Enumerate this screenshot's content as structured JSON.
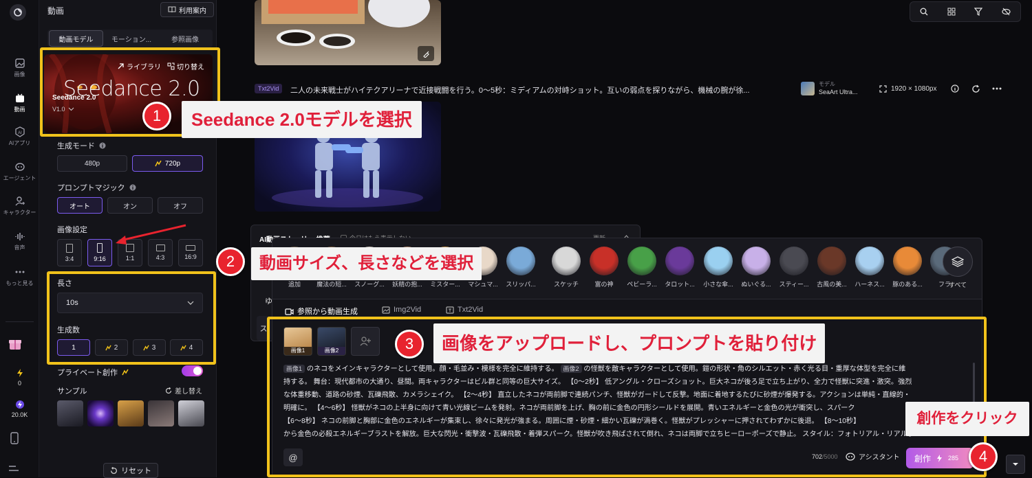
{
  "rail": {
    "items": [
      {
        "label": "画像",
        "icon": "image-icon"
      },
      {
        "label": "動画",
        "icon": "video-icon"
      },
      {
        "label": "AIアプリ",
        "icon": "ai-app-icon"
      },
      {
        "label": "エージェント",
        "icon": "agent-icon"
      },
      {
        "label": "キャラクター",
        "icon": "character-icon"
      },
      {
        "label": "音声",
        "icon": "audio-icon"
      },
      {
        "label": "もっと見る",
        "icon": "more-icon"
      }
    ],
    "stat1": "0",
    "stat2": "20.0K"
  },
  "panel": {
    "title": "動画",
    "guide_label": "利用案内",
    "tabs": [
      "動画モデル",
      "モーション...",
      "参照画像"
    ],
    "model": {
      "library_label": "ライブラリ",
      "switch_label": "切り替え",
      "logo_text": "Seedance 2.0",
      "name": "Seedance 2.0",
      "version": "V1.0"
    },
    "gen_mode": {
      "label": "生成モード",
      "options": [
        "480p",
        "720p"
      ],
      "selected": "720p"
    },
    "prompt_magic": {
      "label": "プロンプトマジック",
      "options": [
        "オート",
        "オン",
        "オフ"
      ],
      "selected": "オート"
    },
    "image_settings": {
      "label": "画像設定",
      "ratios": [
        "3:4",
        "9:16",
        "1:1",
        "4:3",
        "16:9"
      ],
      "selected": "9:16"
    },
    "length": {
      "label": "長さ",
      "value": "10s"
    },
    "count": {
      "label": "生成数",
      "options": [
        "1",
        "2",
        "3",
        "4"
      ],
      "selected": "1"
    },
    "private": {
      "label": "プライベート創作",
      "on": true
    },
    "sample": {
      "label": "サンプル",
      "shuffle_label": "差し替え"
    },
    "reset_label": "リセット"
  },
  "feed": {
    "tag": "Txt2Vid",
    "prompt": "二人の未来戦士がハイテクアリーナで近接戦闘を行う。0〜5秒：ミディアムの対峙ショット。互いの弱点を探りながら、機械の腕が徐...",
    "model_caption": "モデル",
    "model_name": "SeaArt Ultra...",
    "resolution": "1920 × 1080px"
  },
  "popup": {
    "title": "AI動画ストーリー 推薦",
    "checkbox_label": "今日はもう表示しない",
    "refresh_label": "更新",
    "side_label_1": "ゆっ",
    "side_label_2": "ス"
  },
  "styles": {
    "items": [
      {
        "label": "追加",
        "color": "#6a5a48"
      },
      {
        "label": "魔法の短...",
        "color": "#7a5a3a"
      },
      {
        "label": "スノーグ...",
        "color": "#c8c0b8"
      },
      {
        "label": "妖精の抱...",
        "color": "#b88a6a"
      },
      {
        "label": "ミスター...",
        "color": "#d49a48"
      },
      {
        "label": "マシュマ...",
        "color": "#e8d8c8"
      },
      {
        "label": "スリッパ...",
        "color": "#7aaad8"
      },
      {
        "label": "スケッチ",
        "color": "#d8d8d8"
      },
      {
        "label": "富の神",
        "color": "#c83028"
      },
      {
        "label": "ペビーラ...",
        "color": "#48a048"
      },
      {
        "label": "タロット...",
        "color": "#6a3a9a"
      },
      {
        "label": "小さな傘...",
        "color": "#9ad0f0"
      },
      {
        "label": "ぬいぐる...",
        "color": "#c8b0e8"
      },
      {
        "label": "スティー...",
        "color": "#4a4a52"
      },
      {
        "label": "古風の美...",
        "color": "#6a3828"
      },
      {
        "label": "ハーネス...",
        "color": "#a8d0f0"
      },
      {
        "label": "豚のある...",
        "color": "#e88a38"
      },
      {
        "label": "フラ",
        "color": "#5a6a7a"
      }
    ],
    "all_label": "すべて"
  },
  "composer": {
    "tabs": [
      "参照から動画生成",
      "Img2Vid",
      "Txt2Vid"
    ],
    "images": [
      "画像1",
      "画像2"
    ],
    "prompt_line1_tag": "画像1",
    "prompt_line1a": "のネコをメインキャラクターとして使用。顔・毛並み・模様を完全に維持する。",
    "prompt_line1_tag2": "画像2",
    "prompt_line1b": "の怪獣を敵キャラクターとして使用。鎧の形状・角のシルエット・赤く光る目・重厚な体型を完全に維",
    "prompt_line2": "持する。 舞台：現代都市の大通り、昼間。両キャラクターはビル群と同等の巨大サイズ。 【0〜2秒】 低アングル・クローズショット。巨大ネコが後ろ足で立ち上がり、全力で怪獣に突進・激突。強烈",
    "prompt_line3": "な体重移動、道路の砂煙、瓦礫飛散、カメラシェイク。 【2〜4秒】 直立したネコが両前脚で連続パンチ、怪獣がガードして反撃。地面に着地するたびに砂煙が爆発する。アクションは単純・直線的・",
    "prompt_line4": "明確に。 【4〜6秒】 怪獣がネコの上半身に向けて青い光線ビームを発射。ネコが両前脚を上げ、胸の前に金色の円形シールドを展開。青いエネルギーと金色の光が衝突し、スパーク",
    "prompt_line5": "【6〜8秒】 ネコの前脚と胸部に金色のエネルギーが集束し、徐々に発光が強まる。周囲に煙・砂煙・細かい瓦礫が渦巻く。怪獣がプレッシャーに押されてわずかに後退。 【8〜10秒】",
    "prompt_line6": "から金色の必殺エネルギーブラストを解放。巨大な閃光・衝撃波・瓦礫飛散・着弾スパーク。怪獣が吹き飛ばされて倒れ、ネコは両脚で立ちヒーローポーズで静止。 スタイル：フォトリアル・リアルま",
    "char_count": "702",
    "char_max": "/5000",
    "assistant_label": "アシスタント",
    "create_label": "創作",
    "cost": "285"
  },
  "annotations": {
    "c1": "Seedance 2.0モデルを選択",
    "c2": "動画サイズ、長さなどを選択",
    "c3": "画像をアップロードし、プロンプトを貼り付け",
    "c4": "創作をクリック",
    "n1": "1",
    "n2": "2",
    "n3": "3",
    "n4": "4"
  },
  "colors": {
    "accent": "#7c5cf0",
    "highlight": "#f1c21b",
    "marker": "#e8232e"
  }
}
